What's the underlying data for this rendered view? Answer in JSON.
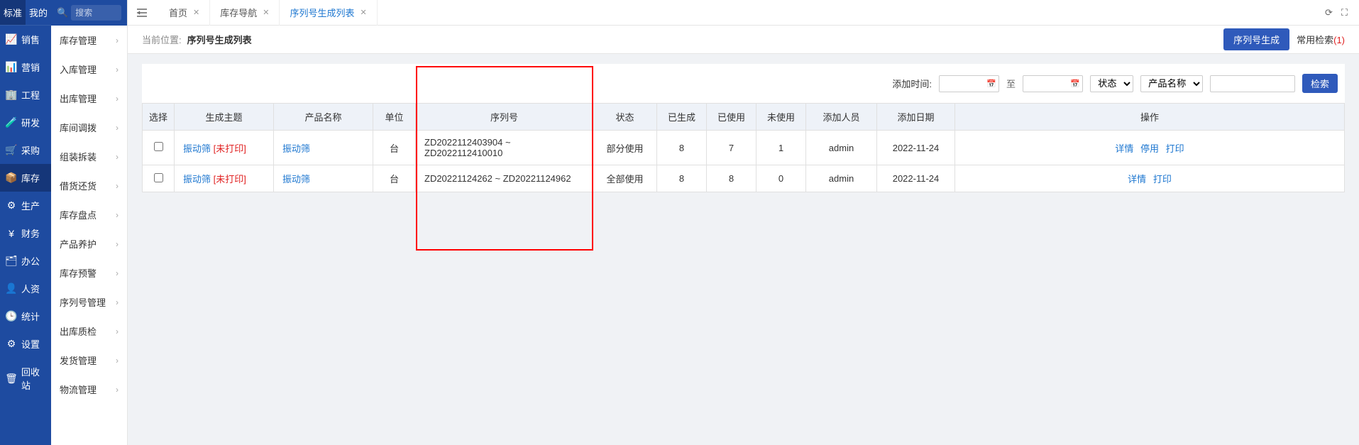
{
  "nav_tabs": {
    "standard": "标准",
    "mine": "我的"
  },
  "search_placeholder": "搜索",
  "primary_nav": [
    {
      "icon": "📈",
      "label": "销售"
    },
    {
      "icon": "📊",
      "label": "营销"
    },
    {
      "icon": "🏢",
      "label": "工程"
    },
    {
      "icon": "🧪",
      "label": "研发"
    },
    {
      "icon": "🛒",
      "label": "采购"
    },
    {
      "icon": "📦",
      "label": "库存"
    },
    {
      "icon": "⚙",
      "label": "生产"
    },
    {
      "icon": "¥",
      "label": "财务"
    },
    {
      "icon": "🗂",
      "label": "办公"
    },
    {
      "icon": "👤",
      "label": "人资"
    },
    {
      "icon": "🕒",
      "label": "统计"
    },
    {
      "icon": "⚙",
      "label": "设置"
    },
    {
      "icon": "🗑",
      "label": "回收站"
    }
  ],
  "secondary_nav": [
    "库存管理",
    "入库管理",
    "出库管理",
    "库间调拨",
    "组装拆装",
    "借货还货",
    "库存盘点",
    "产品养护",
    "库存预警",
    "序列号管理",
    "出库质检",
    "发货管理",
    "物流管理"
  ],
  "tabs": [
    {
      "label": "首页",
      "closable": true,
      "active": false
    },
    {
      "label": "库存导航",
      "closable": true,
      "active": false
    },
    {
      "label": "序列号生成列表",
      "closable": true,
      "active": true
    }
  ],
  "breadcrumb": {
    "label": "当前位置:",
    "current": "序列号生成列表"
  },
  "actions": {
    "generate": "序列号生成",
    "saved_search": "常用检索",
    "saved_count": "(1)"
  },
  "filters": {
    "add_time": "添加时间:",
    "to": "至",
    "status_label": "状态",
    "product_label": "产品名称",
    "search": "检索"
  },
  "table": {
    "headers": [
      "选择",
      "生成主题",
      "产品名称",
      "单位",
      "序列号",
      "状态",
      "已生成",
      "已使用",
      "未使用",
      "添加人员",
      "添加日期",
      "操作"
    ],
    "rows": [
      {
        "topic": "振动筛",
        "badge": "[未打印]",
        "product": "振动筛",
        "unit": "台",
        "serial": "ZD2022112403904 ~ ZD2022112410010",
        "status": "部分使用",
        "generated": "8",
        "used": "7",
        "unused": "1",
        "adder": "admin",
        "date": "2022-11-24",
        "ops": [
          "详情",
          "停用",
          "打印"
        ]
      },
      {
        "topic": "振动筛",
        "badge": "[未打印]",
        "product": "振动筛",
        "unit": "台",
        "serial": "ZD20221124262 ~ ZD20221124962",
        "status": "全部使用",
        "generated": "8",
        "used": "8",
        "unused": "0",
        "adder": "admin",
        "date": "2022-11-24",
        "ops": [
          "详情",
          "打印"
        ]
      }
    ]
  }
}
